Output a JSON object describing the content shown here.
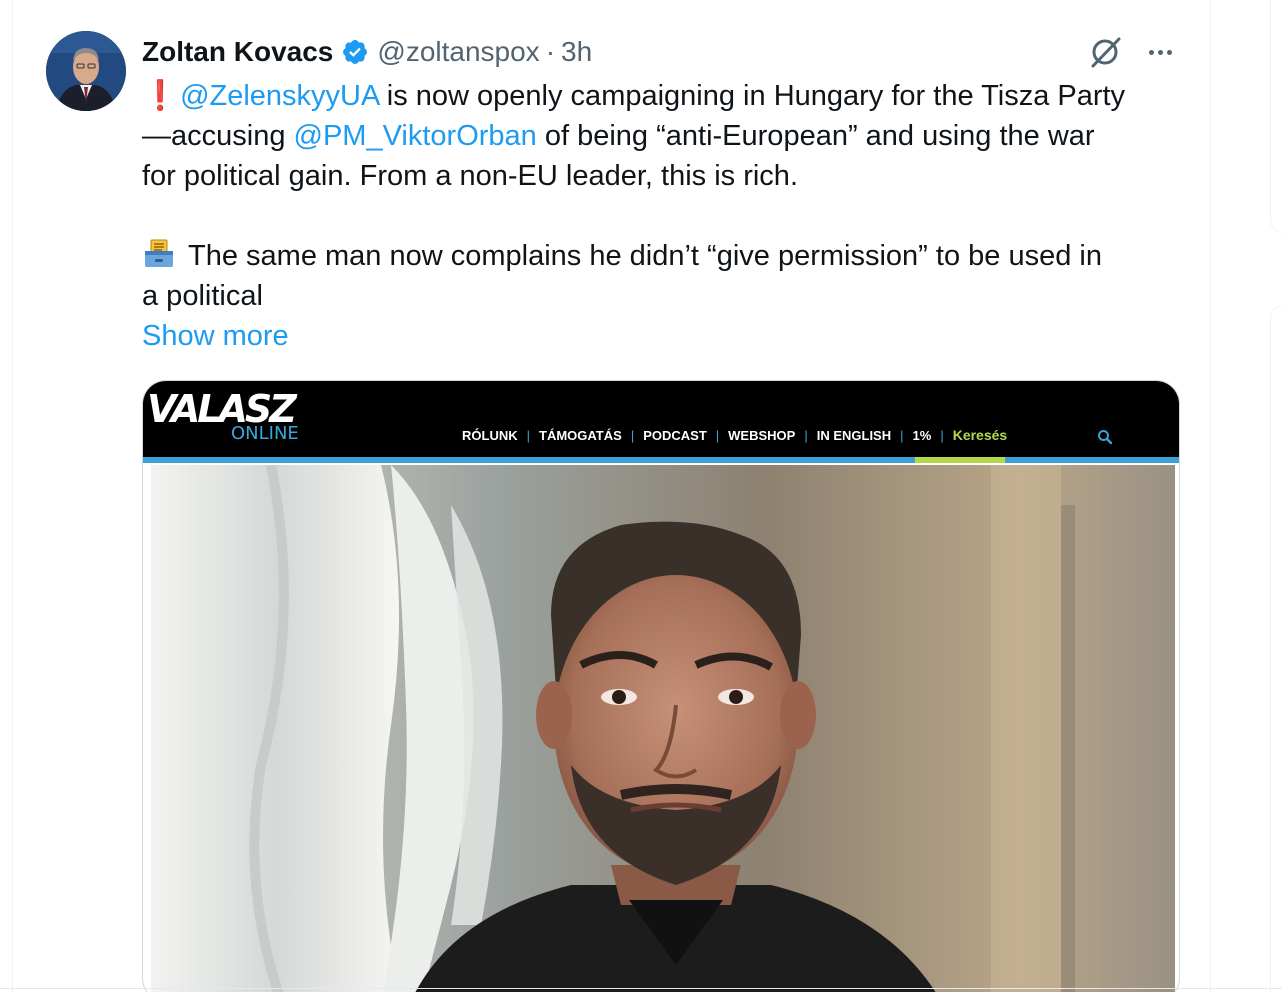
{
  "tweet": {
    "author_name": "Zoltan Kovacs",
    "handle": "@zoltanspox",
    "separator": "·",
    "time": "3h",
    "line1_mention": "@ZelenskyyUA",
    "line1_text": " is now openly campaigning in Hungary for the Tisza Party",
    "line2_prefix": "—accusing ",
    "line2_mention": "@PM_ViktorOrban",
    "line2_text": " of being “anti-European” and using the war",
    "line3_text": "for political gain. From a non-EU leader, this is rich.",
    "line4_text": "The same man now complains he didn’t “give permission” to be used in",
    "line5_text": "a political",
    "show_more": "Show more",
    "exclaim_glyph": "❗",
    "icons": [
      "verified-badge-icon",
      "grok-icon",
      "more-icon",
      "exclamation-icon",
      "ballot-box-icon"
    ]
  },
  "media": {
    "site_logo": "VALASZ",
    "site_logo_sub": "ONLINE",
    "nav": [
      "RÓLUNK",
      "TÁMOGATÁS",
      "PODCAST",
      "WEBSHOP",
      "IN ENGLISH",
      "1%"
    ],
    "nav_separator": "|",
    "search_label": "Keresés",
    "colors": {
      "header_bg": "#000000",
      "stripe_blue": "#3ba1d6",
      "stripe_green": "#b5d84a"
    }
  },
  "colors": {
    "link": "#1d9bf0",
    "text": "#0f1419",
    "secondary": "#536471"
  }
}
